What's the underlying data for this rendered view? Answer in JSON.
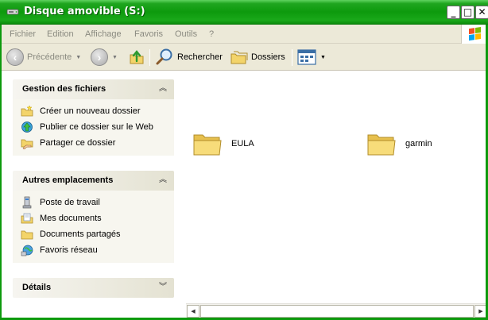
{
  "window": {
    "title": "Disque amovible (S:)",
    "controls": {
      "minimize": "_",
      "maximize": "□",
      "close": "✕"
    }
  },
  "menubar": {
    "items": [
      "Fichier",
      "Edition",
      "Affichage",
      "Favoris",
      "Outils",
      "?"
    ]
  },
  "toolbar": {
    "back_label": "Précédente",
    "search_label": "Rechercher",
    "folders_label": "Dossiers"
  },
  "panels": {
    "file_tasks": {
      "title": "Gestion des fichiers",
      "items": [
        "Créer un nouveau dossier",
        "Publier ce dossier sur le Web",
        "Partager ce dossier"
      ]
    },
    "other_places": {
      "title": "Autres emplacements",
      "items": [
        "Poste de travail",
        "Mes documents",
        "Documents partagés",
        "Favoris réseau"
      ]
    },
    "details": {
      "title": "Détails"
    }
  },
  "files": [
    "EULA",
    "garmin"
  ],
  "colors": {
    "titlebar": "#0d9a0d",
    "chrome": "#ece9d8",
    "panel_body": "#f7f6ef",
    "folder": "#f5d870"
  }
}
